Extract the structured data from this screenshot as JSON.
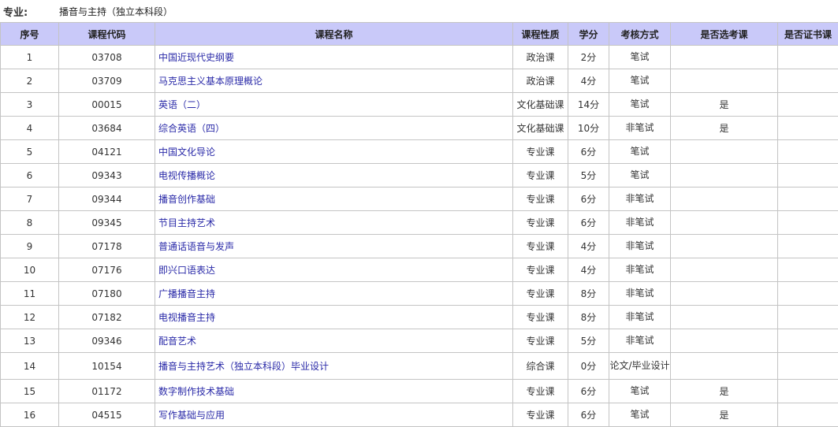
{
  "major": {
    "label": "专业:",
    "value": "播音与主持（独立本科段）"
  },
  "headers": [
    "序号",
    "课程代码",
    "课程名称",
    "课程性质",
    "学分",
    "考核方式",
    "是否选考课",
    "是否证书课"
  ],
  "rows": [
    {
      "no": "1",
      "code": "03708",
      "name": "中国近现代史纲要",
      "type": "政治课",
      "credit": "2分",
      "method": "笔试",
      "elective": "",
      "cert": ""
    },
    {
      "no": "2",
      "code": "03709",
      "name": "马克思主义基本原理概论",
      "type": "政治课",
      "credit": "4分",
      "method": "笔试",
      "elective": "",
      "cert": ""
    },
    {
      "no": "3",
      "code": "00015",
      "name": "英语（二）",
      "type": "文化基础课",
      "credit": "14分",
      "method": "笔试",
      "elective": "是",
      "cert": ""
    },
    {
      "no": "4",
      "code": "03684",
      "name": "综合英语（四）",
      "type": "文化基础课",
      "credit": "10分",
      "method": "非笔试",
      "elective": "是",
      "cert": ""
    },
    {
      "no": "5",
      "code": "04121",
      "name": "中国文化导论",
      "type": "专业课",
      "credit": "6分",
      "method": "笔试",
      "elective": "",
      "cert": ""
    },
    {
      "no": "6",
      "code": "09343",
      "name": "电视传播概论",
      "type": "专业课",
      "credit": "5分",
      "method": "笔试",
      "elective": "",
      "cert": ""
    },
    {
      "no": "7",
      "code": "09344",
      "name": "播音创作基础",
      "type": "专业课",
      "credit": "6分",
      "method": "非笔试",
      "elective": "",
      "cert": ""
    },
    {
      "no": "8",
      "code": "09345",
      "name": "节目主持艺术",
      "type": "专业课",
      "credit": "6分",
      "method": "非笔试",
      "elective": "",
      "cert": ""
    },
    {
      "no": "9",
      "code": "07178",
      "name": "普通话语音与发声",
      "type": "专业课",
      "credit": "4分",
      "method": "非笔试",
      "elective": "",
      "cert": ""
    },
    {
      "no": "10",
      "code": "07176",
      "name": "即兴口语表达",
      "type": "专业课",
      "credit": "4分",
      "method": "非笔试",
      "elective": "",
      "cert": ""
    },
    {
      "no": "11",
      "code": "07180",
      "name": "广播播音主持",
      "type": "专业课",
      "credit": "8分",
      "method": "非笔试",
      "elective": "",
      "cert": ""
    },
    {
      "no": "12",
      "code": "07182",
      "name": "电视播音主持",
      "type": "专业课",
      "credit": "8分",
      "method": "非笔试",
      "elective": "",
      "cert": ""
    },
    {
      "no": "13",
      "code": "09346",
      "name": "配音艺术",
      "type": "专业课",
      "credit": "5分",
      "method": "非笔试",
      "elective": "",
      "cert": ""
    },
    {
      "no": "14",
      "code": "10154",
      "name": "播音与主持艺术（独立本科段）毕业设计",
      "type": "综合课",
      "credit": "0分",
      "method": "论文/毕业设计",
      "elective": "",
      "cert": ""
    },
    {
      "no": "15",
      "code": "01172",
      "name": "数字制作技术基础",
      "type": "专业课",
      "credit": "6分",
      "method": "笔试",
      "elective": "是",
      "cert": ""
    },
    {
      "no": "16",
      "code": "04515",
      "name": "写作基础与应用",
      "type": "专业课",
      "credit": "6分",
      "method": "笔试",
      "elective": "是",
      "cert": ""
    }
  ]
}
